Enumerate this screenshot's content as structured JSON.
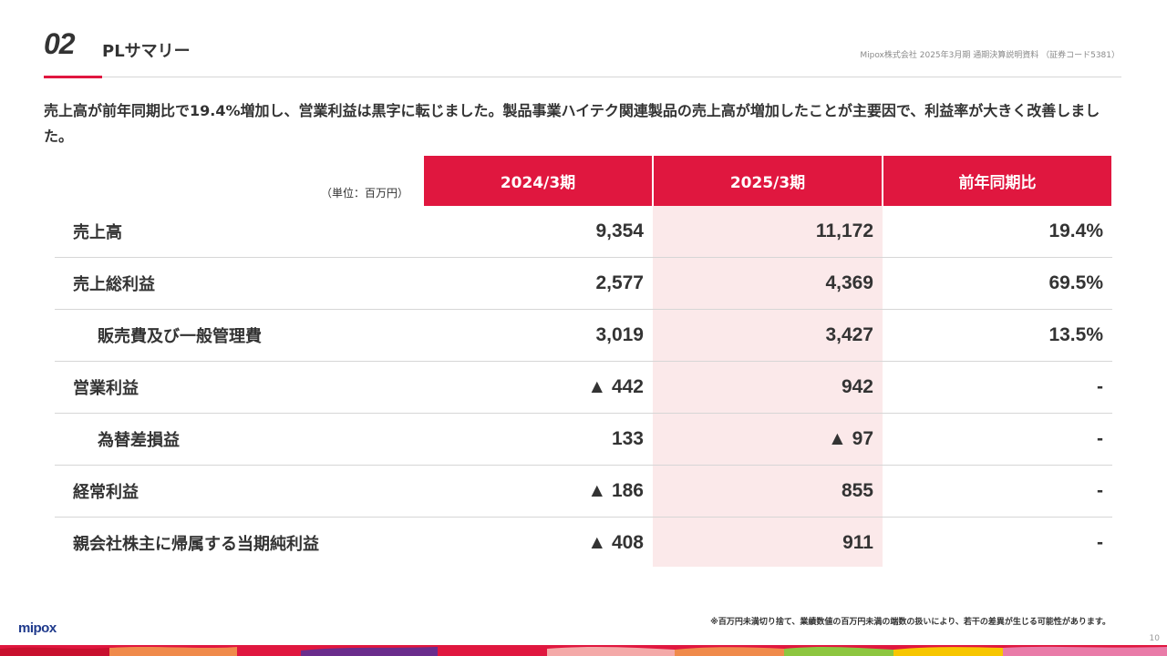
{
  "header": {
    "section_number": "02",
    "title": "PLサマリー",
    "document_reference": "Mipox株式会社 2025年3月期 通期決算説明資料 （証券コード5381）"
  },
  "lead_text": "売上高が前年同期比で19.4%増加し、営業利益は黒字に転じました。製品事業ハイテク関連製品の売上高が増加したことが主要因で、利益率が大きく改善しました。",
  "table": {
    "unit_label": "（単位：百万円）",
    "columns": [
      "2024/3期",
      "2025/3期",
      "前年同期比"
    ],
    "rows": [
      {
        "label": "売上高",
        "fy2024": "9,354",
        "fy2025": "11,172",
        "yoy": "19.4%"
      },
      {
        "label": "売上総利益",
        "fy2024": "2,577",
        "fy2025": "4,369",
        "yoy": "69.5%"
      },
      {
        "label": "販売費及び一般管理費",
        "fy2024": "3,019",
        "fy2025": "3,427",
        "yoy": "13.5%"
      },
      {
        "label": "営業利益",
        "fy2024": "▲ 442",
        "fy2025": "942",
        "yoy": "-"
      },
      {
        "label": "為替差損益",
        "fy2024": "133",
        "fy2025": "▲ 97",
        "yoy": "-"
      },
      {
        "label": "経常利益",
        "fy2024": "▲ 186",
        "fy2025": "855",
        "yoy": "-"
      },
      {
        "label": "親会社株主に帰属する当期純利益",
        "fy2024": "▲ 408",
        "fy2025": "911",
        "yoy": "-"
      }
    ]
  },
  "footnote": "※百万円未満切り捨て、業績数値の百万円未満の端数の扱いにより、若干の差異が生じる可能性があります。",
  "footer": {
    "logo": "mipox",
    "page_number": "10"
  },
  "colors": {
    "accent": "#e0173f",
    "highlight_column": "#fbe9ea",
    "text": "#333333",
    "logo": "#1f3a8c"
  }
}
